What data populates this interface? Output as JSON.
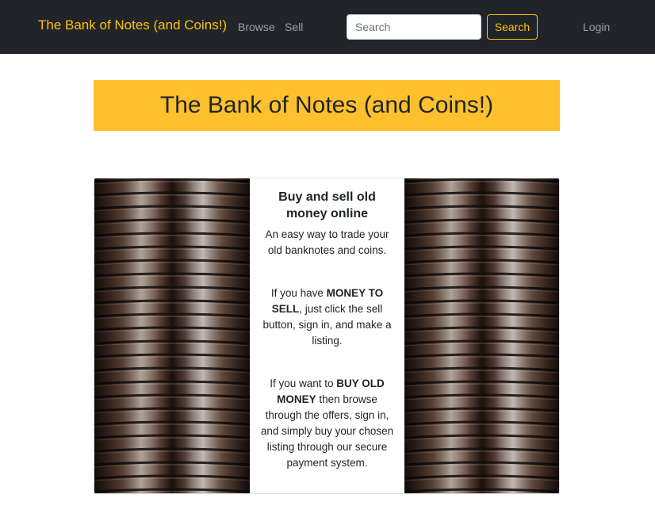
{
  "navbar": {
    "brand": "The Bank of Notes (and Coins!)",
    "links": [
      {
        "label": "Browse"
      },
      {
        "label": "Sell"
      }
    ],
    "search": {
      "placeholder": "Search",
      "value": "",
      "button_label": "Search"
    },
    "login_label": "Login"
  },
  "banner": {
    "title": "The Bank of Notes (and Coins!)"
  },
  "card": {
    "heading": "Buy and sell old money online",
    "intro": "An easy way to trade your old banknotes and coins.",
    "sell": {
      "prefix": "If you have ",
      "emphasis": "MONEY TO SELL",
      "suffix": ", just click the sell button, sign in, and make a listing."
    },
    "buy": {
      "prefix": "If you want to ",
      "emphasis": "BUY OLD MONEY",
      "suffix": " then browse through the offers, sign in, and simply buy your chosen listing through our secure payment system."
    },
    "images": [
      {
        "icon": "coin-stack-image"
      },
      {
        "icon": "coin-stack-image"
      }
    ]
  },
  "colors": {
    "navbar_bg": "#212529",
    "accent": "#ffc107",
    "banner_bg": "#ffc02d"
  }
}
